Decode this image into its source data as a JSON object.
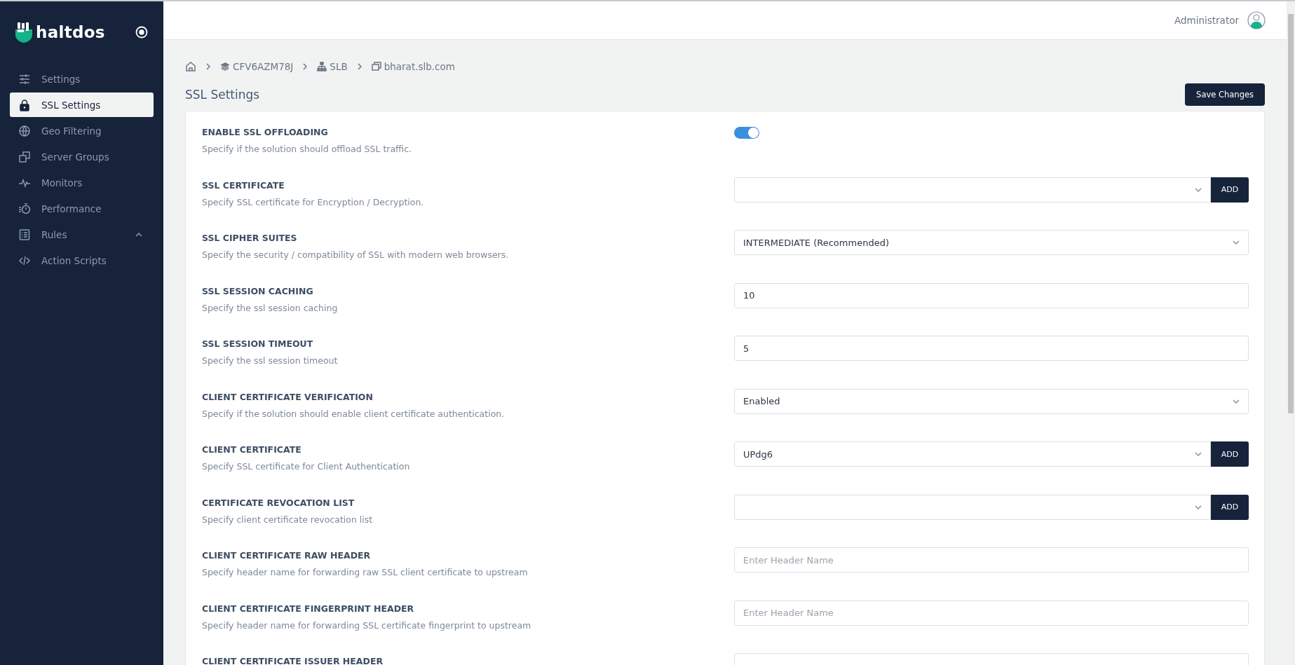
{
  "brand": {
    "name": "haltdos"
  },
  "sidebar": {
    "items": [
      {
        "label": "Settings",
        "selected": false
      },
      {
        "label": "SSL Settings",
        "selected": true
      },
      {
        "label": "Geo Filtering",
        "selected": false
      },
      {
        "label": "Server Groups",
        "selected": false
      },
      {
        "label": "Monitors",
        "selected": false
      },
      {
        "label": "Performance",
        "selected": false
      },
      {
        "label": "Rules",
        "selected": false,
        "expanded": true
      },
      {
        "label": "Action Scripts",
        "selected": false
      }
    ]
  },
  "header": {
    "user": "Administrator"
  },
  "breadcrumb": [
    {
      "label": "CFV6AZM78J"
    },
    {
      "label": "SLB"
    },
    {
      "label": "bharat.slb.com"
    }
  ],
  "page": {
    "title": "SSL Settings",
    "save_button": "Save Changes"
  },
  "settings": [
    {
      "kind": "toggle",
      "label": "ENABLE SSL OFFLOADING",
      "description": "Specify if the solution should offload SSL traffic.",
      "on": true
    },
    {
      "kind": "select_add",
      "label": "SSL CERTIFICATE",
      "description": "Specify SSL certificate for Encryption / Decryption.",
      "button": "ADD"
    },
    {
      "kind": "select",
      "label": "SSL CIPHER SUITES",
      "description": "Specify the security / compatibility of SSL with modern web browsers.",
      "value": "INTERMEDIATE (Recommended)"
    },
    {
      "kind": "input",
      "label": "SSL SESSION CACHING",
      "description": "Specify the ssl session caching",
      "value": "10"
    },
    {
      "kind": "input",
      "label": "SSL SESSION TIMEOUT",
      "description": "Specify the ssl session timeout",
      "value": "5"
    },
    {
      "kind": "select",
      "label": "CLIENT CERTIFICATE VERIFICATION",
      "description": "Specify if the solution should enable client certificate authentication.",
      "value": "Enabled"
    },
    {
      "kind": "select_add",
      "label": "CLIENT CERTIFICATE",
      "description": "Specify SSL certificate for Client Authentication",
      "value": "UPdg6",
      "button": "ADD"
    },
    {
      "kind": "select_add",
      "label": "CERTIFICATE REVOCATION LIST",
      "description": "Specify client certificate revocation list",
      "button": "ADD"
    },
    {
      "kind": "input",
      "label": "CLIENT CERTIFICATE RAW HEADER",
      "description": "Specify header name for forwarding raw SSL client certificate to upstream",
      "placeholder": "Enter Header Name"
    },
    {
      "kind": "input",
      "label": "CLIENT CERTIFICATE FINGERPRINT HEADER",
      "description": "Specify header name for forwarding SSL certificate fingerprint to upstream",
      "placeholder": "Enter Header Name"
    },
    {
      "kind": "input",
      "label": "CLIENT CERTIFICATE ISSUER HEADER"
    }
  ]
}
